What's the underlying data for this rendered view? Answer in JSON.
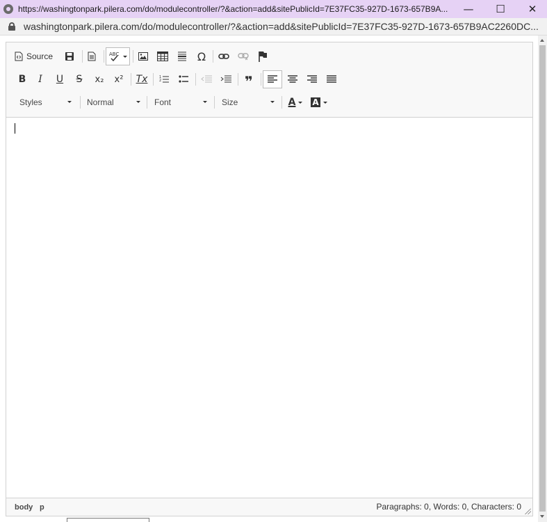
{
  "window": {
    "title": "https://washingtonpark.pilera.com/do/modulecontroller/?&action=add&sitePublicId=7E37FC35-927D-1673-657B9A...",
    "minimize": "—",
    "maximize": "☐",
    "close": "✕"
  },
  "address": {
    "url": "washingtonpark.pilera.com/do/modulecontroller/?&action=add&sitePublicId=7E37FC35-927D-1673-657B9AC2260DC..."
  },
  "toolbar": {
    "source_label": "Source",
    "styles_label": "Styles",
    "format_label": "Normal",
    "font_label": "Font",
    "size_label": "Size",
    "bold": "B",
    "italic": "I",
    "underline": "U",
    "strike": "S",
    "subscript": "x₂",
    "superscript": "x²",
    "remove_format": "Tx",
    "omega": "Ω",
    "blockquote": "❞",
    "text_color": "A",
    "bg_color": "A",
    "icons": [
      "source-icon",
      "save-icon",
      "templates-icon",
      "spellcheck-icon",
      "image-icon",
      "table-icon",
      "horizontal-rule-icon",
      "special-char-icon",
      "link-icon",
      "unlink-icon",
      "anchor-icon",
      "numbered-list-icon",
      "bulleted-list-icon",
      "outdent-icon",
      "indent-icon",
      "blockquote-icon",
      "align-left-icon",
      "align-center-icon",
      "align-right-icon",
      "justify-icon"
    ]
  },
  "statusbar": {
    "path": [
      "body",
      "p"
    ],
    "wordcount": "Paragraphs: 0, Words: 0, Characters: 0"
  },
  "colors": {
    "titlebar_bg": "#e6d2f5",
    "toolbar_bg": "#f8f8f8",
    "border": "#d1d1d1"
  }
}
